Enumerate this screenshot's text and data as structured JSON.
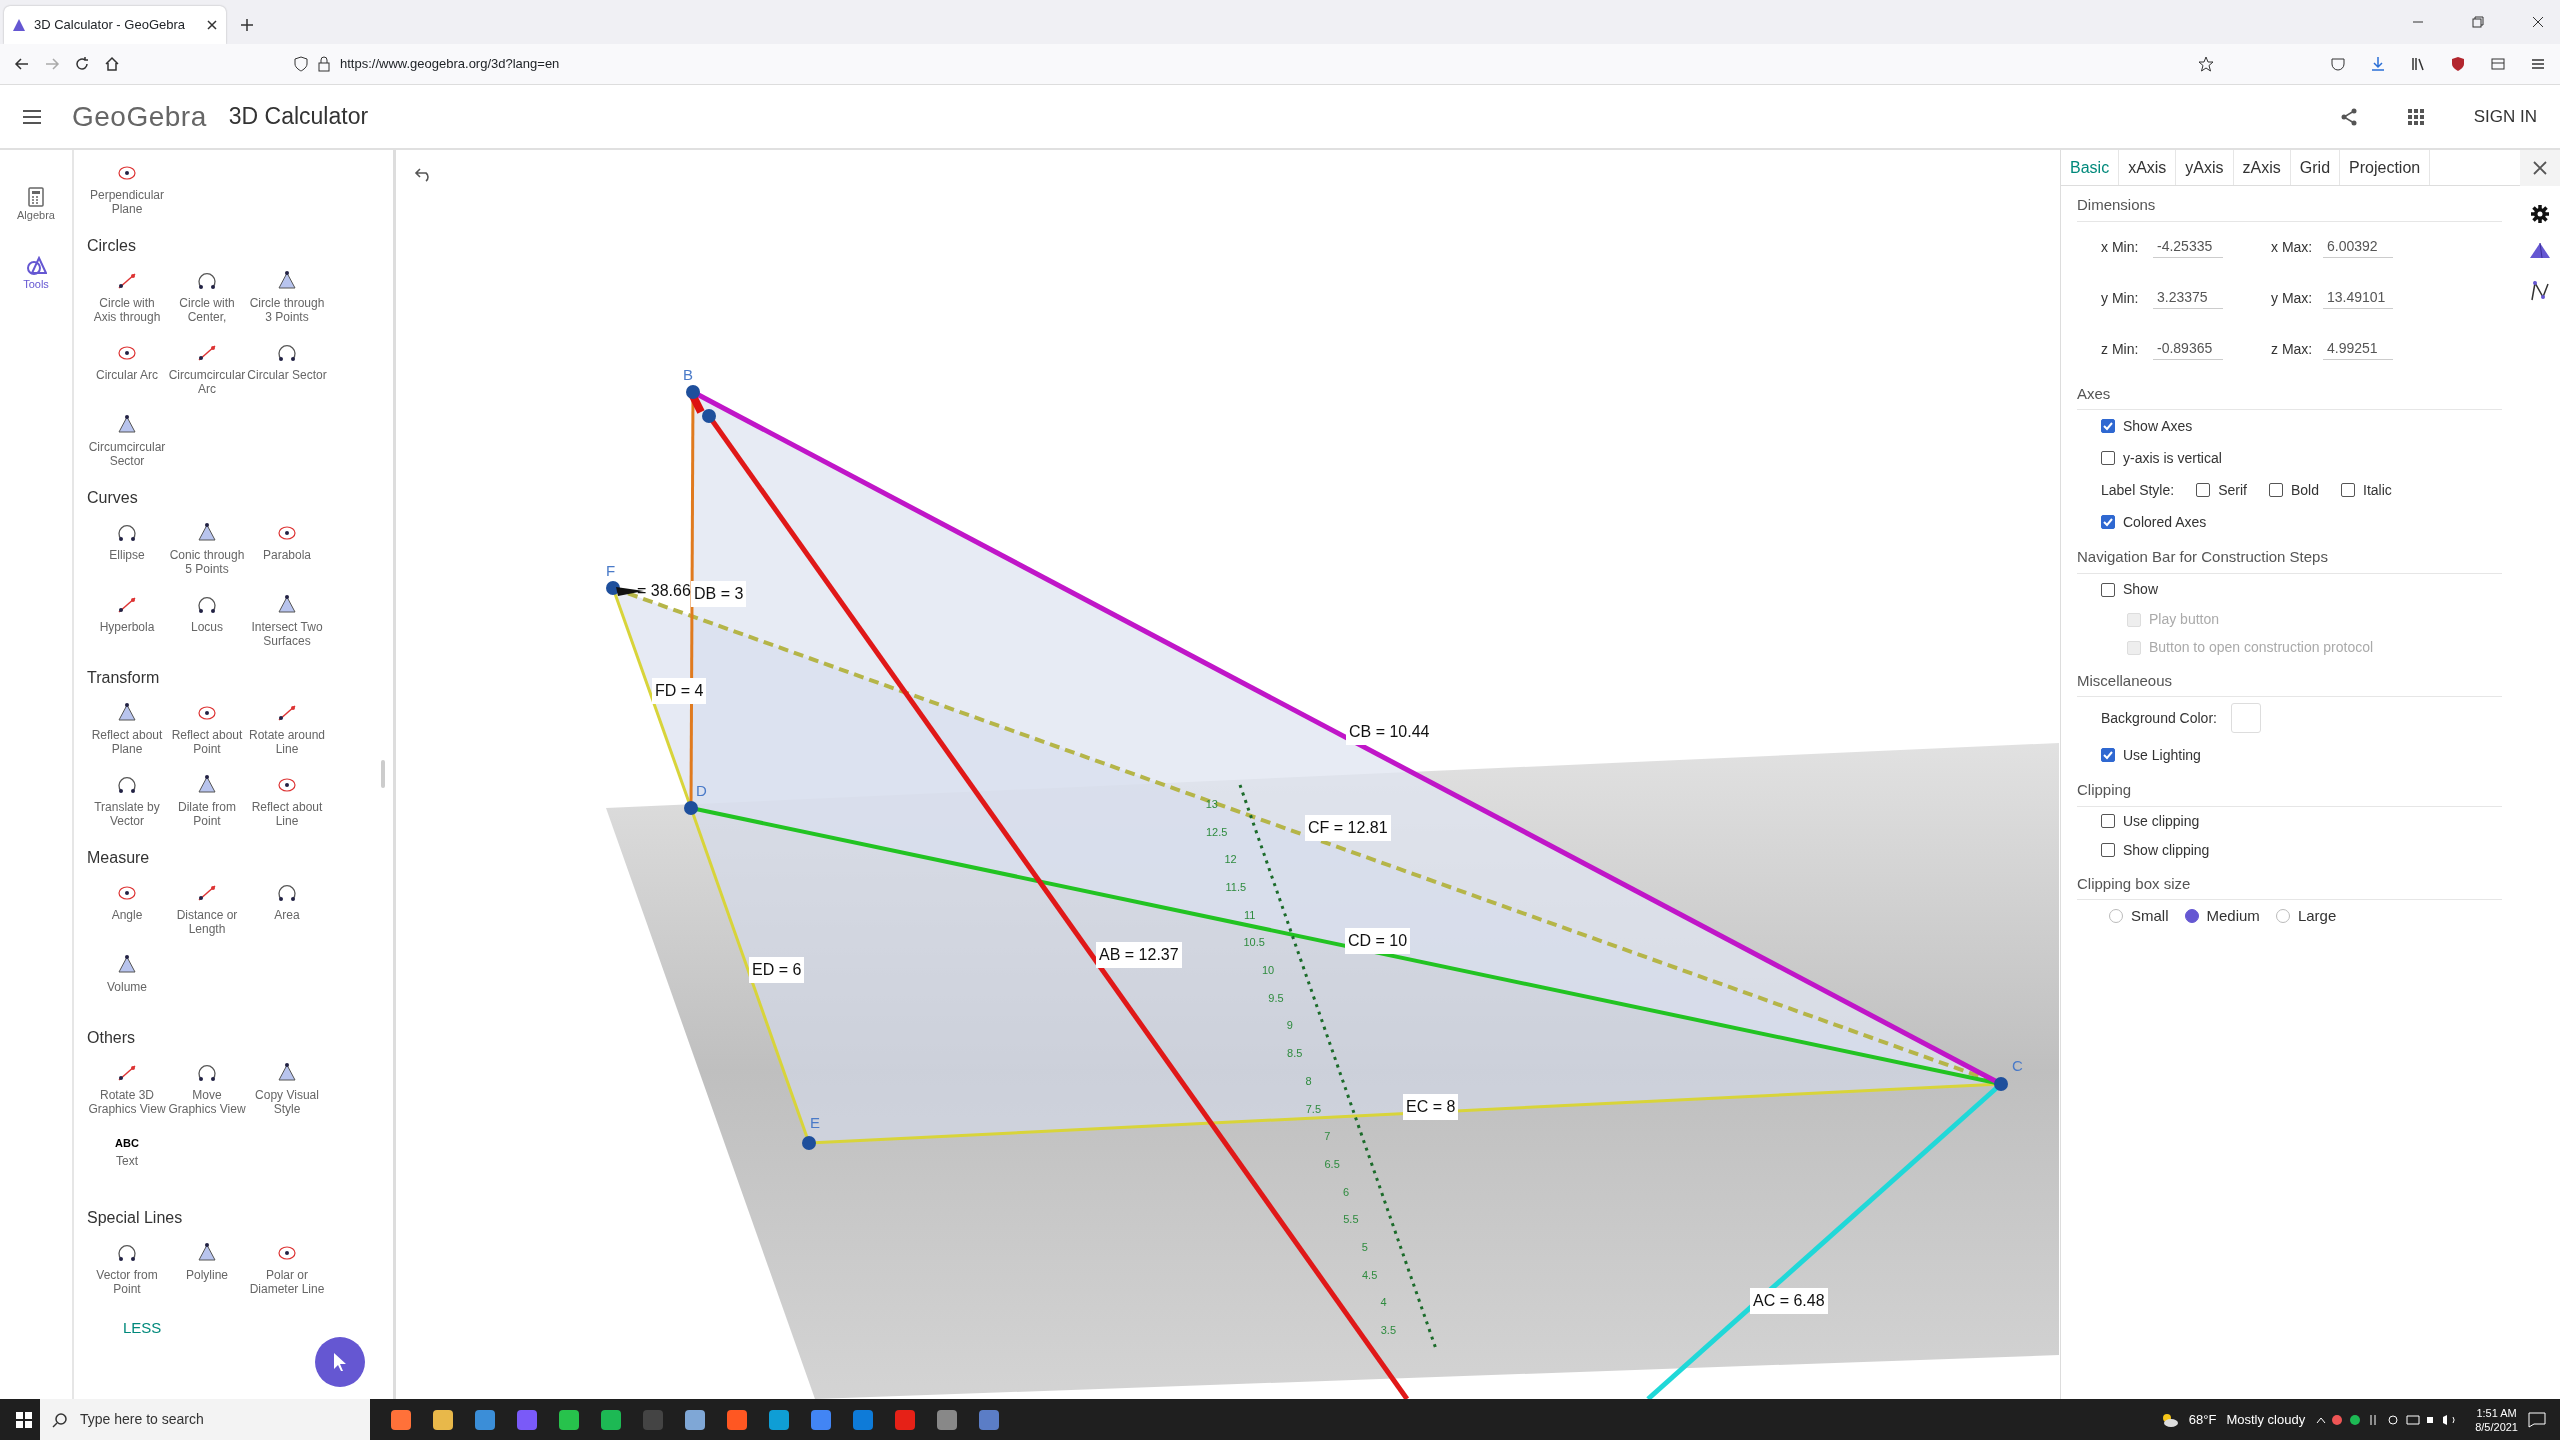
{
  "browser": {
    "tab_title": "3D Calculator - GeoGebra",
    "url": "https://www.geogebra.org/3d?lang=en"
  },
  "app_header": {
    "logo": "GeoGebra",
    "title": "3D Calculator",
    "sign_in": "SIGN IN"
  },
  "side_rail": [
    {
      "label": "Algebra",
      "selected": false
    },
    {
      "label": "Tools",
      "selected": true
    }
  ],
  "tools": {
    "sections": [
      {
        "tools": [
          {
            "label": "Perpendicular Plane"
          }
        ]
      },
      {
        "title": "Circles",
        "tools": [
          {
            "label": "Circle with Axis through"
          },
          {
            "label": "Circle with Center,"
          },
          {
            "label": "Circle through 3 Points"
          },
          {
            "label": "Circular Arc"
          },
          {
            "label": "Circumcircular Arc"
          },
          {
            "label": "Circular Sector"
          },
          {
            "label": "Circumcircular Sector"
          }
        ]
      },
      {
        "title": "Curves",
        "tools": [
          {
            "label": "Ellipse"
          },
          {
            "label": "Conic through 5 Points"
          },
          {
            "label": "Parabola"
          },
          {
            "label": "Hyperbola"
          },
          {
            "label": "Locus"
          },
          {
            "label": "Intersect Two Surfaces"
          }
        ]
      },
      {
        "title": "Transform",
        "tools": [
          {
            "label": "Reflect about Plane"
          },
          {
            "label": "Reflect about Point"
          },
          {
            "label": "Rotate around Line"
          },
          {
            "label": "Translate by Vector"
          },
          {
            "label": "Dilate from Point"
          },
          {
            "label": "Reflect about Line"
          }
        ]
      },
      {
        "title": "Measure",
        "tools": [
          {
            "label": "Angle"
          },
          {
            "label": "Distance or Length"
          },
          {
            "label": "Area"
          },
          {
            "label": "Volume"
          }
        ]
      },
      {
        "title": "Others",
        "tools": [
          {
            "label": "Rotate 3D Graphics View"
          },
          {
            "label": "Move Graphics View"
          },
          {
            "label": "Copy Visual Style"
          },
          {
            "label": "Text",
            "icon_text": "ABC"
          }
        ]
      },
      {
        "title": "Special Lines",
        "tools": [
          {
            "label": "Vector from Point"
          },
          {
            "label": "Polyline"
          },
          {
            "label": "Polar or Diameter Line"
          }
        ]
      }
    ],
    "less": "LESS"
  },
  "graphics": {
    "points": [
      {
        "label": "B"
      },
      {
        "label": "F"
      },
      {
        "label": "D"
      },
      {
        "label": "E"
      },
      {
        "label": "C"
      }
    ],
    "segment_labels": [
      "DB = 3",
      "= 38.66",
      "FD = 4",
      "CB = 10.44",
      "CF = 12.81",
      "CD = 10",
      "AB = 12.37",
      "ED = 6",
      "EC = 8",
      "AC = 6.48"
    ],
    "ruler_ticks": [
      "13",
      "12.5",
      "12",
      "11.5",
      "11",
      "10.5",
      "10",
      "9.5",
      "9",
      "8.5",
      "8",
      "7.5",
      "7",
      "6.5",
      "6",
      "5.5",
      "5",
      "4.5",
      "4",
      "3.5"
    ]
  },
  "settings": {
    "tabs": [
      {
        "label": "Basic",
        "selected": true
      },
      {
        "label": "xAxis",
        "selected": false
      },
      {
        "label": "yAxis",
        "selected": false
      },
      {
        "label": "zAxis",
        "selected": false
      },
      {
        "label": "Grid",
        "selected": false
      },
      {
        "label": "Projection",
        "selected": false
      }
    ],
    "dimensions": {
      "title": "Dimensions",
      "rows": [
        {
          "min_label": "x Min:",
          "min": "-4.25335",
          "max_label": "x Max:",
          "max": "6.00392"
        },
        {
          "min_label": "y Min:",
          "min": "3.23375",
          "max_label": "y Max:",
          "max": "13.49101"
        },
        {
          "min_label": "z Min:",
          "min": "-0.89365",
          "max_label": "z Max:",
          "max": "4.99251"
        }
      ]
    },
    "axes": {
      "title": "Axes",
      "show_axes": {
        "label": "Show Axes",
        "checked": true
      },
      "y_axis_vertical": {
        "label": "y-axis is vertical",
        "checked": false
      },
      "label_style": {
        "label": "Label Style:",
        "options": [
          {
            "label": "Serif",
            "checked": false
          },
          {
            "label": "Bold",
            "checked": false
          },
          {
            "label": "Italic",
            "checked": false
          }
        ]
      },
      "colored_axes": {
        "label": "Colored Axes",
        "checked": true
      }
    },
    "navigation_bar": {
      "title": "Navigation Bar for Construction Steps",
      "show": {
        "label": "Show",
        "checked": false,
        "disabled": false,
        "children": [
          {
            "label": "Play button",
            "checked": false,
            "disabled": true
          },
          {
            "label": "Button to open construction protocol",
            "checked": false,
            "disabled": true
          }
        ]
      }
    },
    "miscellaneous": {
      "title": "Miscellaneous",
      "background_color": {
        "label": "Background Color:",
        "color": "#ffffff"
      },
      "use_lighting": {
        "label": "Use Lighting",
        "checked": true
      }
    },
    "clipping": {
      "title": "Clipping",
      "options": [
        {
          "label": "Use clipping",
          "checked": false
        },
        {
          "label": "Show clipping",
          "checked": false
        }
      ]
    },
    "clipping_box_size": {
      "title": "Clipping box size",
      "options": [
        {
          "label": "Small",
          "selected": false
        },
        {
          "label": "Medium",
          "selected": true
        },
        {
          "label": "Large",
          "selected": false
        }
      ]
    }
  },
  "taskbar": {
    "search_placeholder": "Type here to search",
    "temperature": "68°F",
    "weather": "Mostly cloudy",
    "time": "1:51 AM",
    "date": "8/5/2021"
  }
}
